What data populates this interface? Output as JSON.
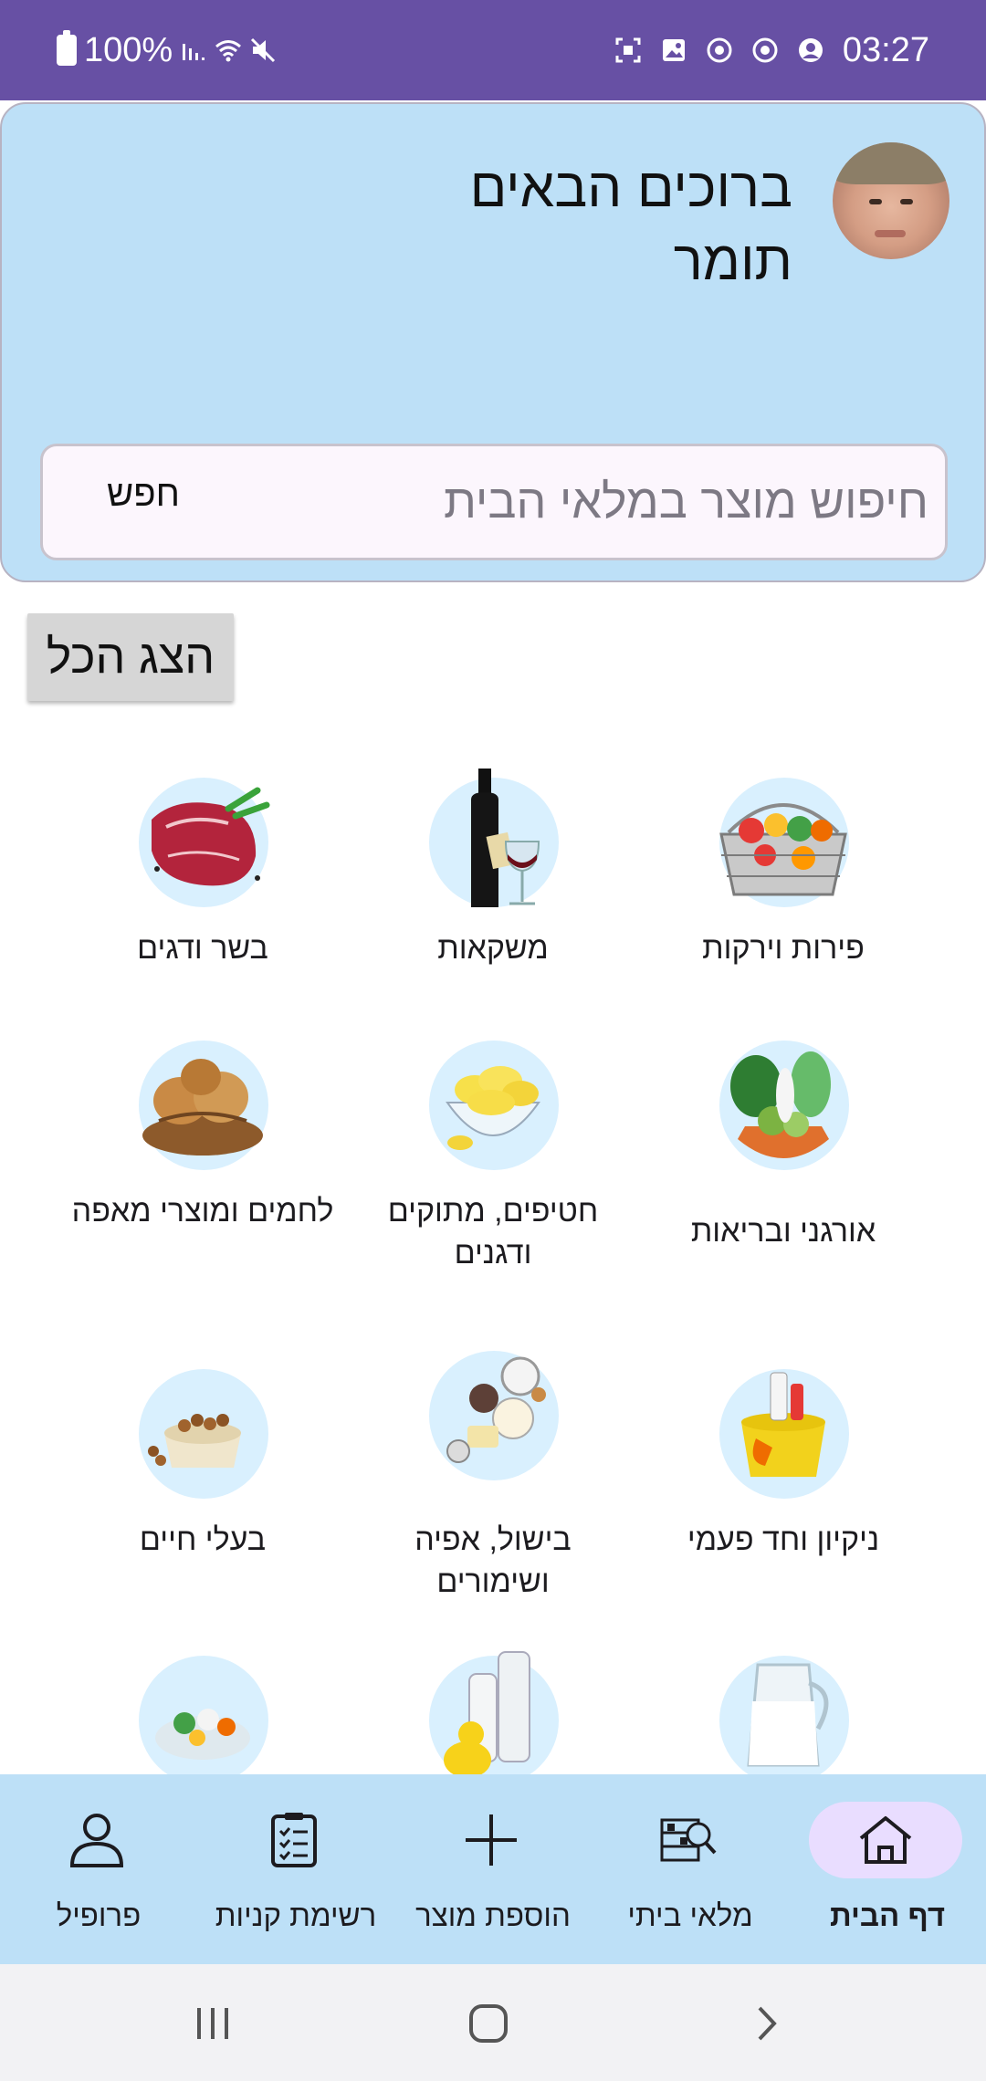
{
  "status_bar": {
    "battery": "100%",
    "time": "03:27",
    "left_icons": [
      "battery-icon",
      "signal-icon",
      "wifi-icon",
      "mute-icon"
    ],
    "right_icons": [
      "screenshot-icon",
      "gallery-icon",
      "sync-icon",
      "sync-icon",
      "account-icon"
    ]
  },
  "header": {
    "greeting": "ברוכים הבאים",
    "user_name": "תומר",
    "search_placeholder": "חיפוש מוצר במלאי הבית",
    "search_button": "חפש"
  },
  "show_all": "הצג הכל",
  "categories": [
    {
      "label": "פירות וירקות",
      "icon": "vegetable-basket-icon"
    },
    {
      "label": "משקאות",
      "icon": "wine-bottle-icon"
    },
    {
      "label": "בשר ודגים",
      "icon": "steak-icon"
    },
    {
      "label": "אורגני ובריאות",
      "icon": "organic-vegetables-icon"
    },
    {
      "label": "חטיפים, מתוקים ודגנים",
      "icon": "chips-bowl-icon"
    },
    {
      "label": "לחמים ומוצרי מאפה",
      "icon": "bread-icon"
    },
    {
      "label": "ניקיון וחד פעמי",
      "icon": "cleaning-bucket-icon"
    },
    {
      "label": "בישול, אפיה ושימורים",
      "icon": "baking-ingredients-icon"
    },
    {
      "label": "בעלי חיים",
      "icon": "pet-food-icon"
    },
    {
      "label": "",
      "icon": "dairy-milk-icon"
    },
    {
      "label": "",
      "icon": "baby-bottles-icon"
    },
    {
      "label": "",
      "icon": "frozen-vegetables-icon"
    }
  ],
  "bottom_nav": [
    {
      "label": "דף הבית",
      "icon": "home-icon",
      "active": true
    },
    {
      "label": "מלאי ביתי",
      "icon": "inventory-icon",
      "active": false
    },
    {
      "label": "הוספת מוצר",
      "icon": "plus-icon",
      "active": false
    },
    {
      "label": "רשימת קניות",
      "icon": "clipboard-icon",
      "active": false
    },
    {
      "label": "פרופיל",
      "icon": "person-icon",
      "active": false
    }
  ],
  "colors": {
    "status_bar": "#6750a4",
    "header_bg": "#bde0f7",
    "category_circle": "#d9f0fe",
    "active_pill": "#e9ddff"
  }
}
